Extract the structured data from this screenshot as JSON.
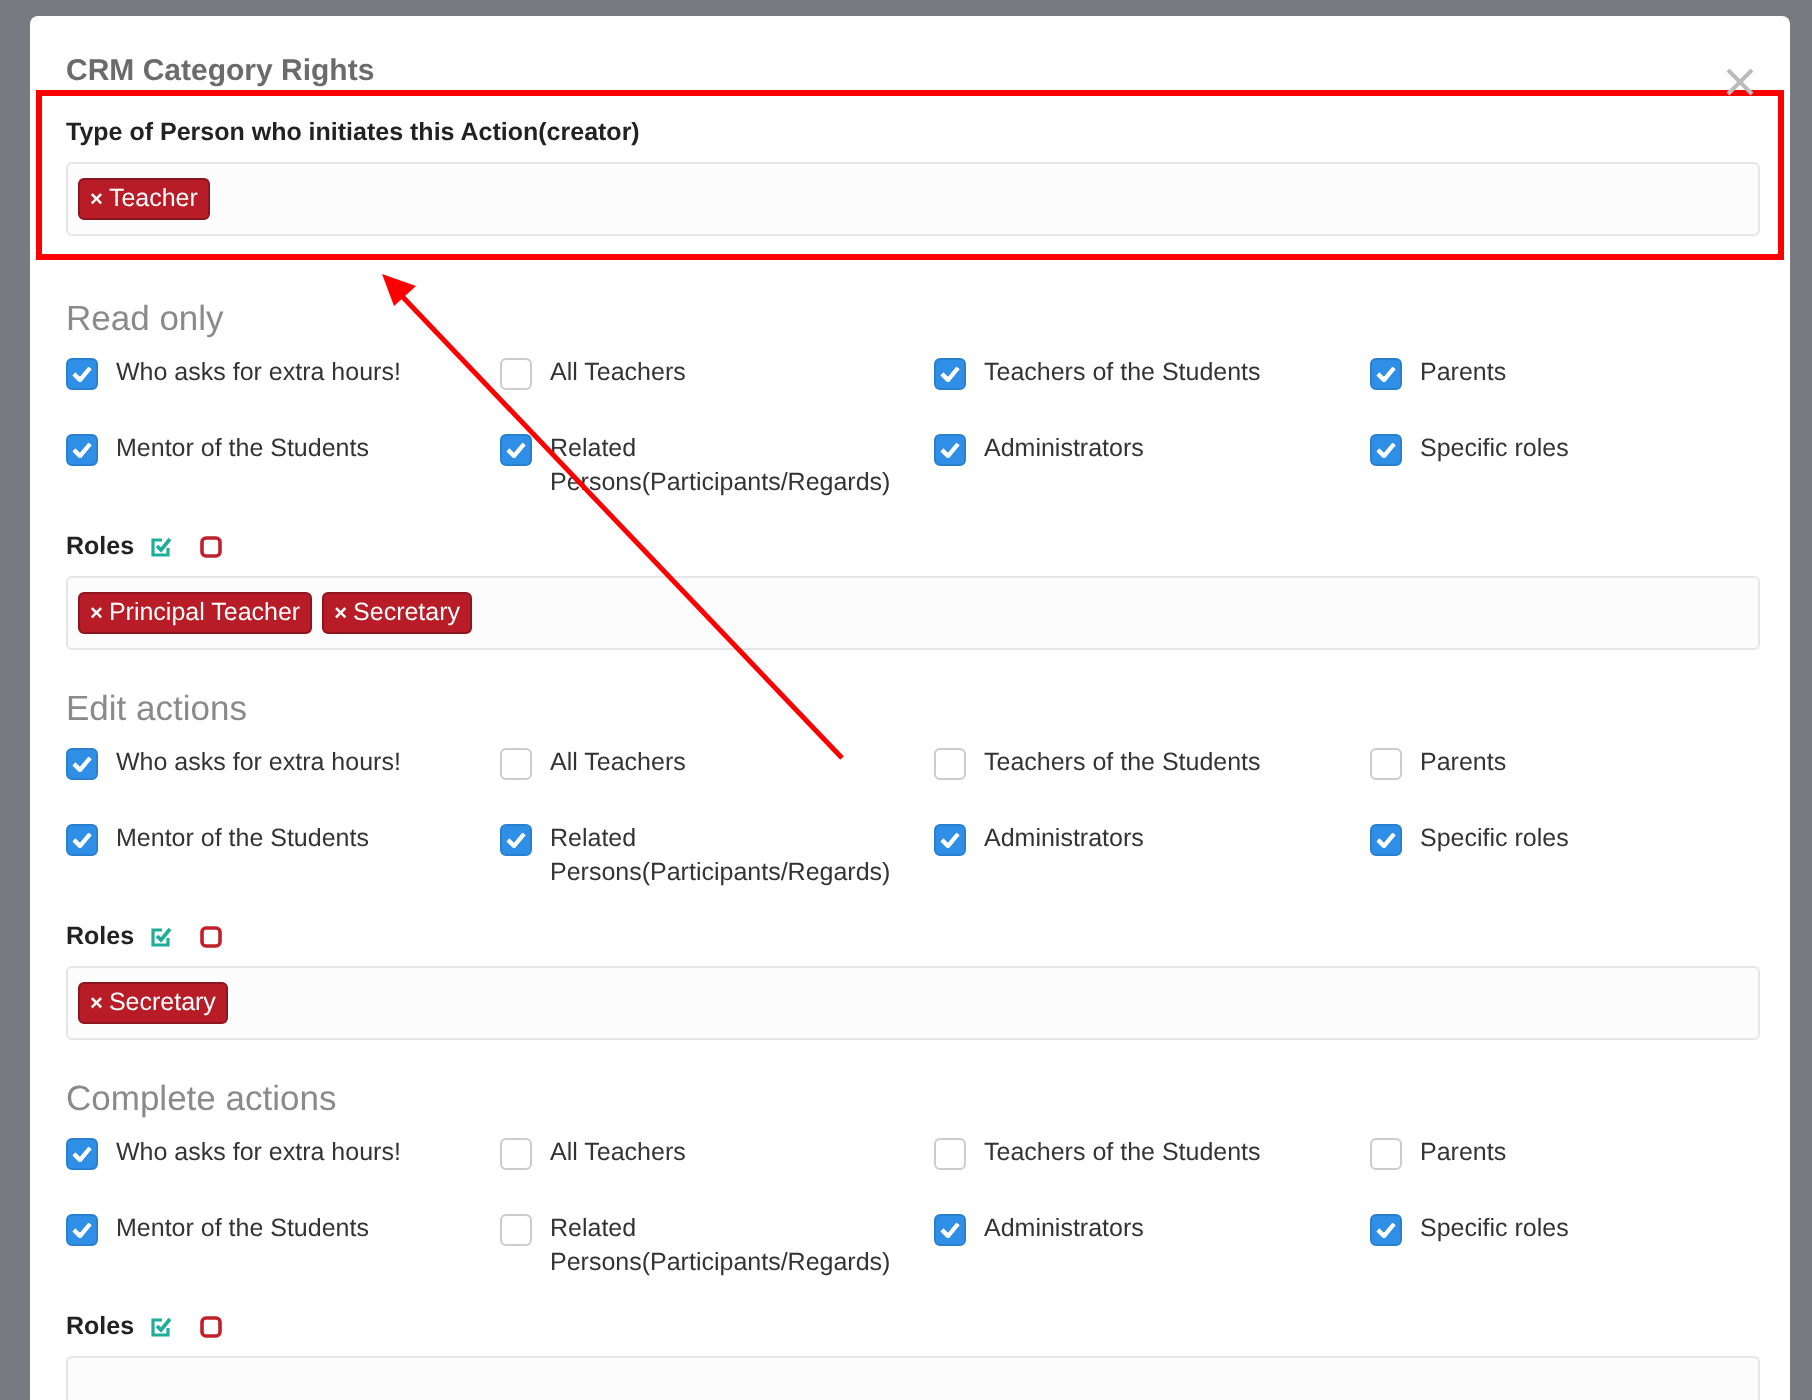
{
  "dialog": {
    "title": "CRM Category Rights"
  },
  "creator": {
    "label": "Type of Person who initiates this Action(creator)",
    "tags": [
      {
        "label": "Teacher",
        "remove": "×"
      }
    ]
  },
  "sections": [
    {
      "title": "Read only",
      "options": [
        {
          "label": "Who asks for extra hours!",
          "checked": true
        },
        {
          "label": "All Teachers",
          "checked": false
        },
        {
          "label": "Teachers of the Students",
          "checked": true
        },
        {
          "label": "Parents",
          "checked": true
        },
        {
          "label": "Mentor of the Students",
          "checked": true
        },
        {
          "label": "Related Persons(Participants/Regards)",
          "checked": true
        },
        {
          "label": "Administrators",
          "checked": true
        },
        {
          "label": "Specific roles",
          "checked": true
        }
      ],
      "roles": {
        "label": "Roles",
        "tags": [
          {
            "label": "Principal Teacher",
            "remove": "×"
          },
          {
            "label": "Secretary",
            "remove": "×"
          }
        ]
      }
    },
    {
      "title": "Edit actions",
      "options": [
        {
          "label": "Who asks for extra hours!",
          "checked": true
        },
        {
          "label": "All Teachers",
          "checked": false
        },
        {
          "label": "Teachers of the Students",
          "checked": false
        },
        {
          "label": "Parents",
          "checked": false
        },
        {
          "label": "Mentor of the Students",
          "checked": true
        },
        {
          "label": "Related Persons(Participants/Regards)",
          "checked": true
        },
        {
          "label": "Administrators",
          "checked": true
        },
        {
          "label": "Specific roles",
          "checked": true
        }
      ],
      "roles": {
        "label": "Roles",
        "tags": [
          {
            "label": "Secretary",
            "remove": "×"
          }
        ]
      }
    },
    {
      "title": "Complete actions",
      "options": [
        {
          "label": "Who asks for extra hours!",
          "checked": true
        },
        {
          "label": "All Teachers",
          "checked": false
        },
        {
          "label": "Teachers of the Students",
          "checked": false
        },
        {
          "label": "Parents",
          "checked": false
        },
        {
          "label": "Mentor of the Students",
          "checked": true
        },
        {
          "label": "Related Persons(Participants/Regards)",
          "checked": false
        },
        {
          "label": "Administrators",
          "checked": true
        },
        {
          "label": "Specific roles",
          "checked": true
        }
      ],
      "roles": {
        "label": "Roles"
      }
    }
  ]
}
